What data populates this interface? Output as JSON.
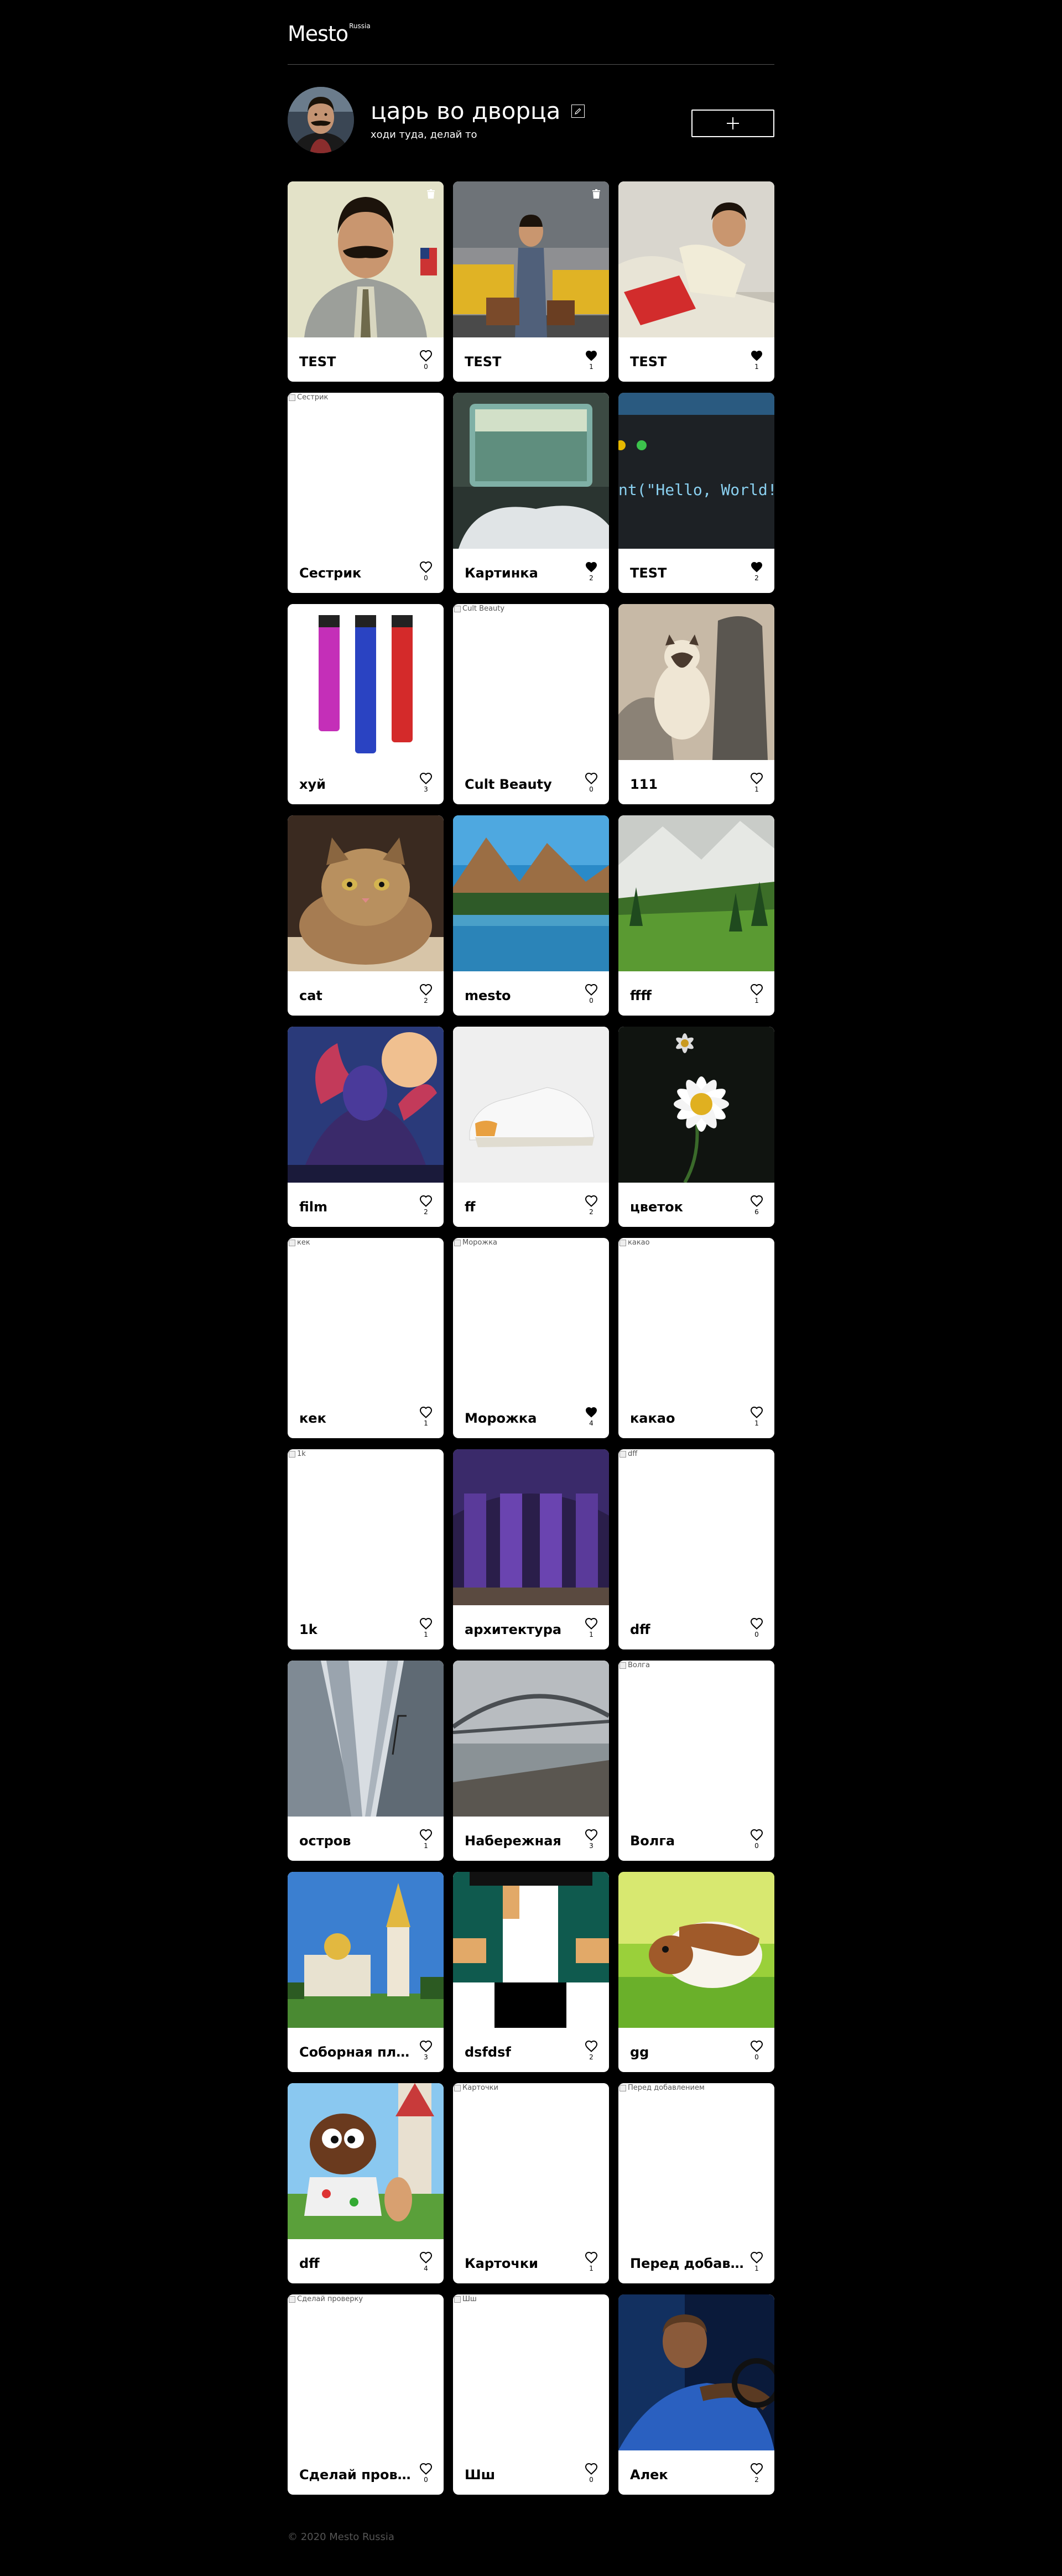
{
  "header": {
    "logo": "Mesto",
    "logo_sub": "Russia"
  },
  "profile": {
    "name": "царь во дворца",
    "about": "ходи туда, делай то"
  },
  "cards": [
    {
      "title": "TEST",
      "likes": "0",
      "liked": false,
      "own": true,
      "img": "borat1"
    },
    {
      "title": "TEST",
      "likes": "1",
      "liked": true,
      "own": true,
      "img": "borat2"
    },
    {
      "title": "TEST",
      "likes": "1",
      "liked": true,
      "own": false,
      "img": "borat3"
    },
    {
      "title": "Сестрик",
      "likes": "0",
      "liked": false,
      "own": false,
      "alt": "Сестрик"
    },
    {
      "title": "Картинка",
      "likes": "2",
      "liked": true,
      "own": false,
      "img": "train"
    },
    {
      "title": "TEST",
      "likes": "2",
      "liked": true,
      "own": false,
      "img": "code",
      "code_text": "nt(\"Hello, World!"
    },
    {
      "title": "хуй",
      "likes": "3",
      "liked": false,
      "own": false,
      "img": "vapes"
    },
    {
      "title": "Cult Beauty",
      "likes": "0",
      "liked": false,
      "own": false,
      "alt": "Cult Beauty"
    },
    {
      "title": "111",
      "likes": "1",
      "liked": false,
      "own": false,
      "img": "siamese"
    },
    {
      "title": "cat",
      "likes": "2",
      "liked": false,
      "own": false,
      "img": "cat"
    },
    {
      "title": "mesto",
      "likes": "0",
      "liked": false,
      "own": false,
      "img": "lake"
    },
    {
      "title": "ffff",
      "likes": "1",
      "liked": false,
      "own": false,
      "img": "forest"
    },
    {
      "title": "film",
      "likes": "2",
      "liked": false,
      "own": false,
      "img": "dragon"
    },
    {
      "title": "ff",
      "likes": "2",
      "liked": false,
      "own": false,
      "img": "sneaker"
    },
    {
      "title": "цветок",
      "likes": "6",
      "liked": false,
      "own": false,
      "img": "daisy"
    },
    {
      "title": "кек",
      "likes": "1",
      "liked": false,
      "own": false,
      "alt": "кек"
    },
    {
      "title": "Морожка",
      "likes": "4",
      "liked": true,
      "own": false,
      "alt": "Морожка"
    },
    {
      "title": "какао",
      "likes": "1",
      "liked": false,
      "own": false,
      "alt": "какао"
    },
    {
      "title": "1k",
      "likes": "1",
      "liked": false,
      "own": false,
      "alt": "1k"
    },
    {
      "title": "архитектура",
      "likes": "1",
      "liked": false,
      "own": false,
      "img": "church"
    },
    {
      "title": "dff",
      "likes": "0",
      "liked": false,
      "own": false,
      "alt": "dff"
    },
    {
      "title": "остров",
      "likes": "1",
      "liked": false,
      "own": false,
      "img": "skyscrapers"
    },
    {
      "title": "Набережная",
      "likes": "3",
      "liked": false,
      "own": false,
      "img": "bridge"
    },
    {
      "title": "Волга",
      "likes": "0",
      "liked": false,
      "own": false,
      "alt": "Волга"
    },
    {
      "title": "Соборная площадь",
      "likes": "3",
      "liked": false,
      "own": false,
      "img": "cathedral"
    },
    {
      "title": "dsfdsf",
      "likes": "2",
      "liked": false,
      "own": false,
      "img": "pixel"
    },
    {
      "title": "gg",
      "likes": "0",
      "liked": false,
      "own": false,
      "img": "guineapig"
    },
    {
      "title": "dff",
      "likes": "4",
      "liked": false,
      "own": false,
      "img": "cartoon"
    },
    {
      "title": "Карточки",
      "likes": "1",
      "liked": false,
      "own": false,
      "alt": "Карточки"
    },
    {
      "title": "Перед добавлением",
      "likes": "1",
      "liked": false,
      "own": false,
      "alt": "Перед добавлением"
    },
    {
      "title": "Сделай проверку",
      "likes": "0",
      "liked": false,
      "own": false,
      "alt": "Сделай проверку"
    },
    {
      "title": "Шш",
      "likes": "0",
      "liked": false,
      "own": false,
      "alt": "Шш"
    },
    {
      "title": "Алек",
      "likes": "2",
      "liked": false,
      "own": false,
      "img": "driver"
    }
  ],
  "footer": {
    "copyright": "© 2020 Mesto Russia"
  },
  "icons": {
    "edit": "pencil-icon",
    "add": "plus-icon",
    "like": "heart-icon",
    "delete": "trash-icon"
  },
  "colors": {
    "background": "#000000",
    "card": "#ffffff",
    "text_primary": "#ffffff",
    "footer_text": "#545454"
  }
}
